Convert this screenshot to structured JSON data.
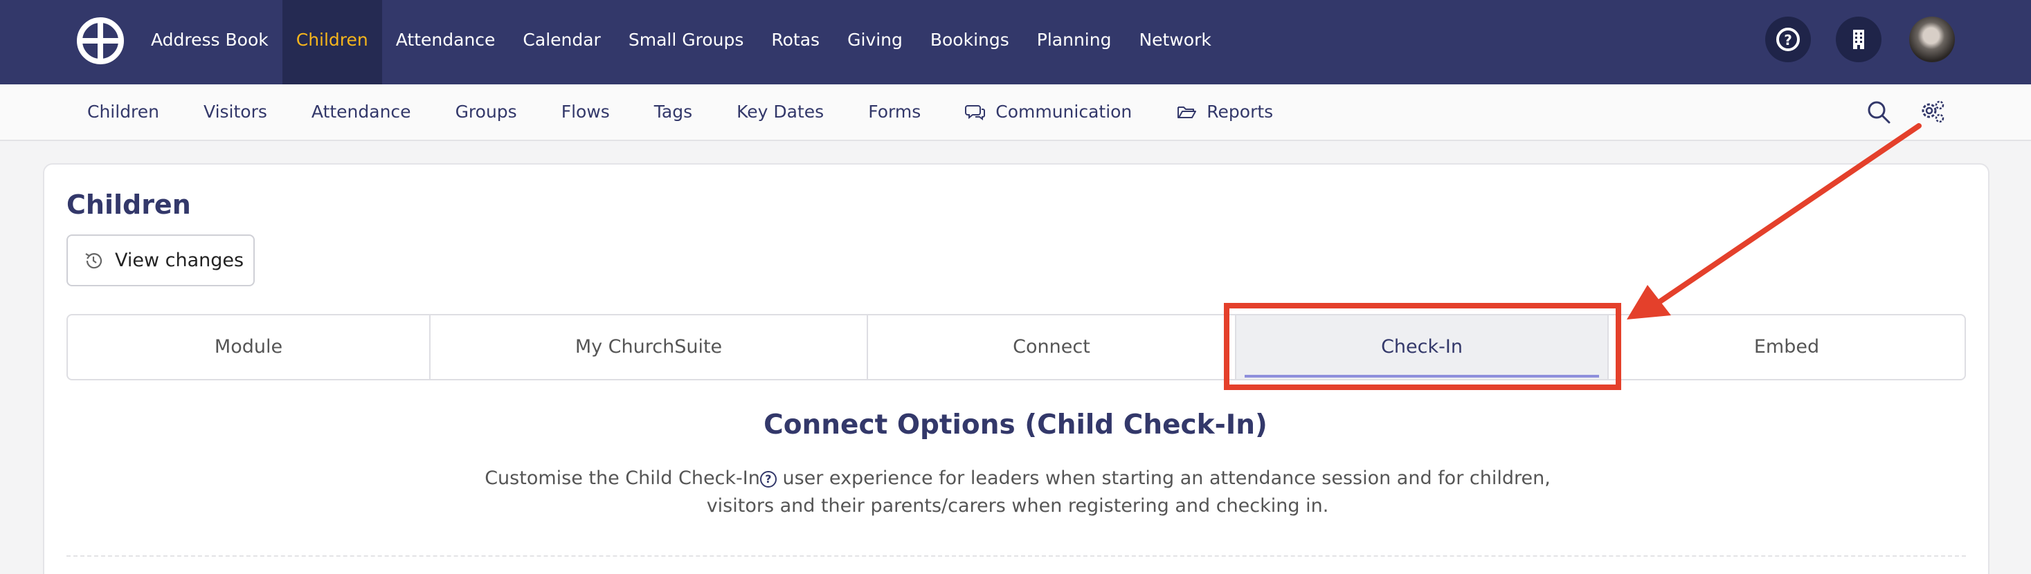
{
  "topnav": {
    "items": [
      "Address Book",
      "Children",
      "Attendance",
      "Calendar",
      "Small Groups",
      "Rotas",
      "Giving",
      "Bookings",
      "Planning",
      "Network"
    ],
    "active": "Children",
    "accent_color": "#f5b51c",
    "bar_color": "#33386a"
  },
  "top_icons": [
    "help-icon",
    "building-icon",
    "avatar"
  ],
  "subnav": {
    "items": [
      "Children",
      "Visitors",
      "Attendance",
      "Groups",
      "Flows",
      "Tags",
      "Key Dates",
      "Forms",
      "Communication",
      "Reports"
    ],
    "icons": {
      "Communication": "chat-bubbles-icon",
      "Reports": "folder-open-icon"
    },
    "right_icons": [
      "search-icon",
      "settings-gears-icon"
    ]
  },
  "page": {
    "title": "Children",
    "view_changes_label": "View changes"
  },
  "tabs": {
    "items": [
      "Module",
      "My ChurchSuite",
      "Connect",
      "Check-In",
      "Embed"
    ],
    "active": "Check-In"
  },
  "section": {
    "title": "Connect Options (Child Check-In)",
    "desc_part1": "Customise the Child Check-In",
    "desc_part2": " user experience for leaders when starting an attendance session and for children, visitors and their parents/carers when registering and checking in."
  },
  "annotation": {
    "color": "#e4402b",
    "target": "Check-In"
  }
}
